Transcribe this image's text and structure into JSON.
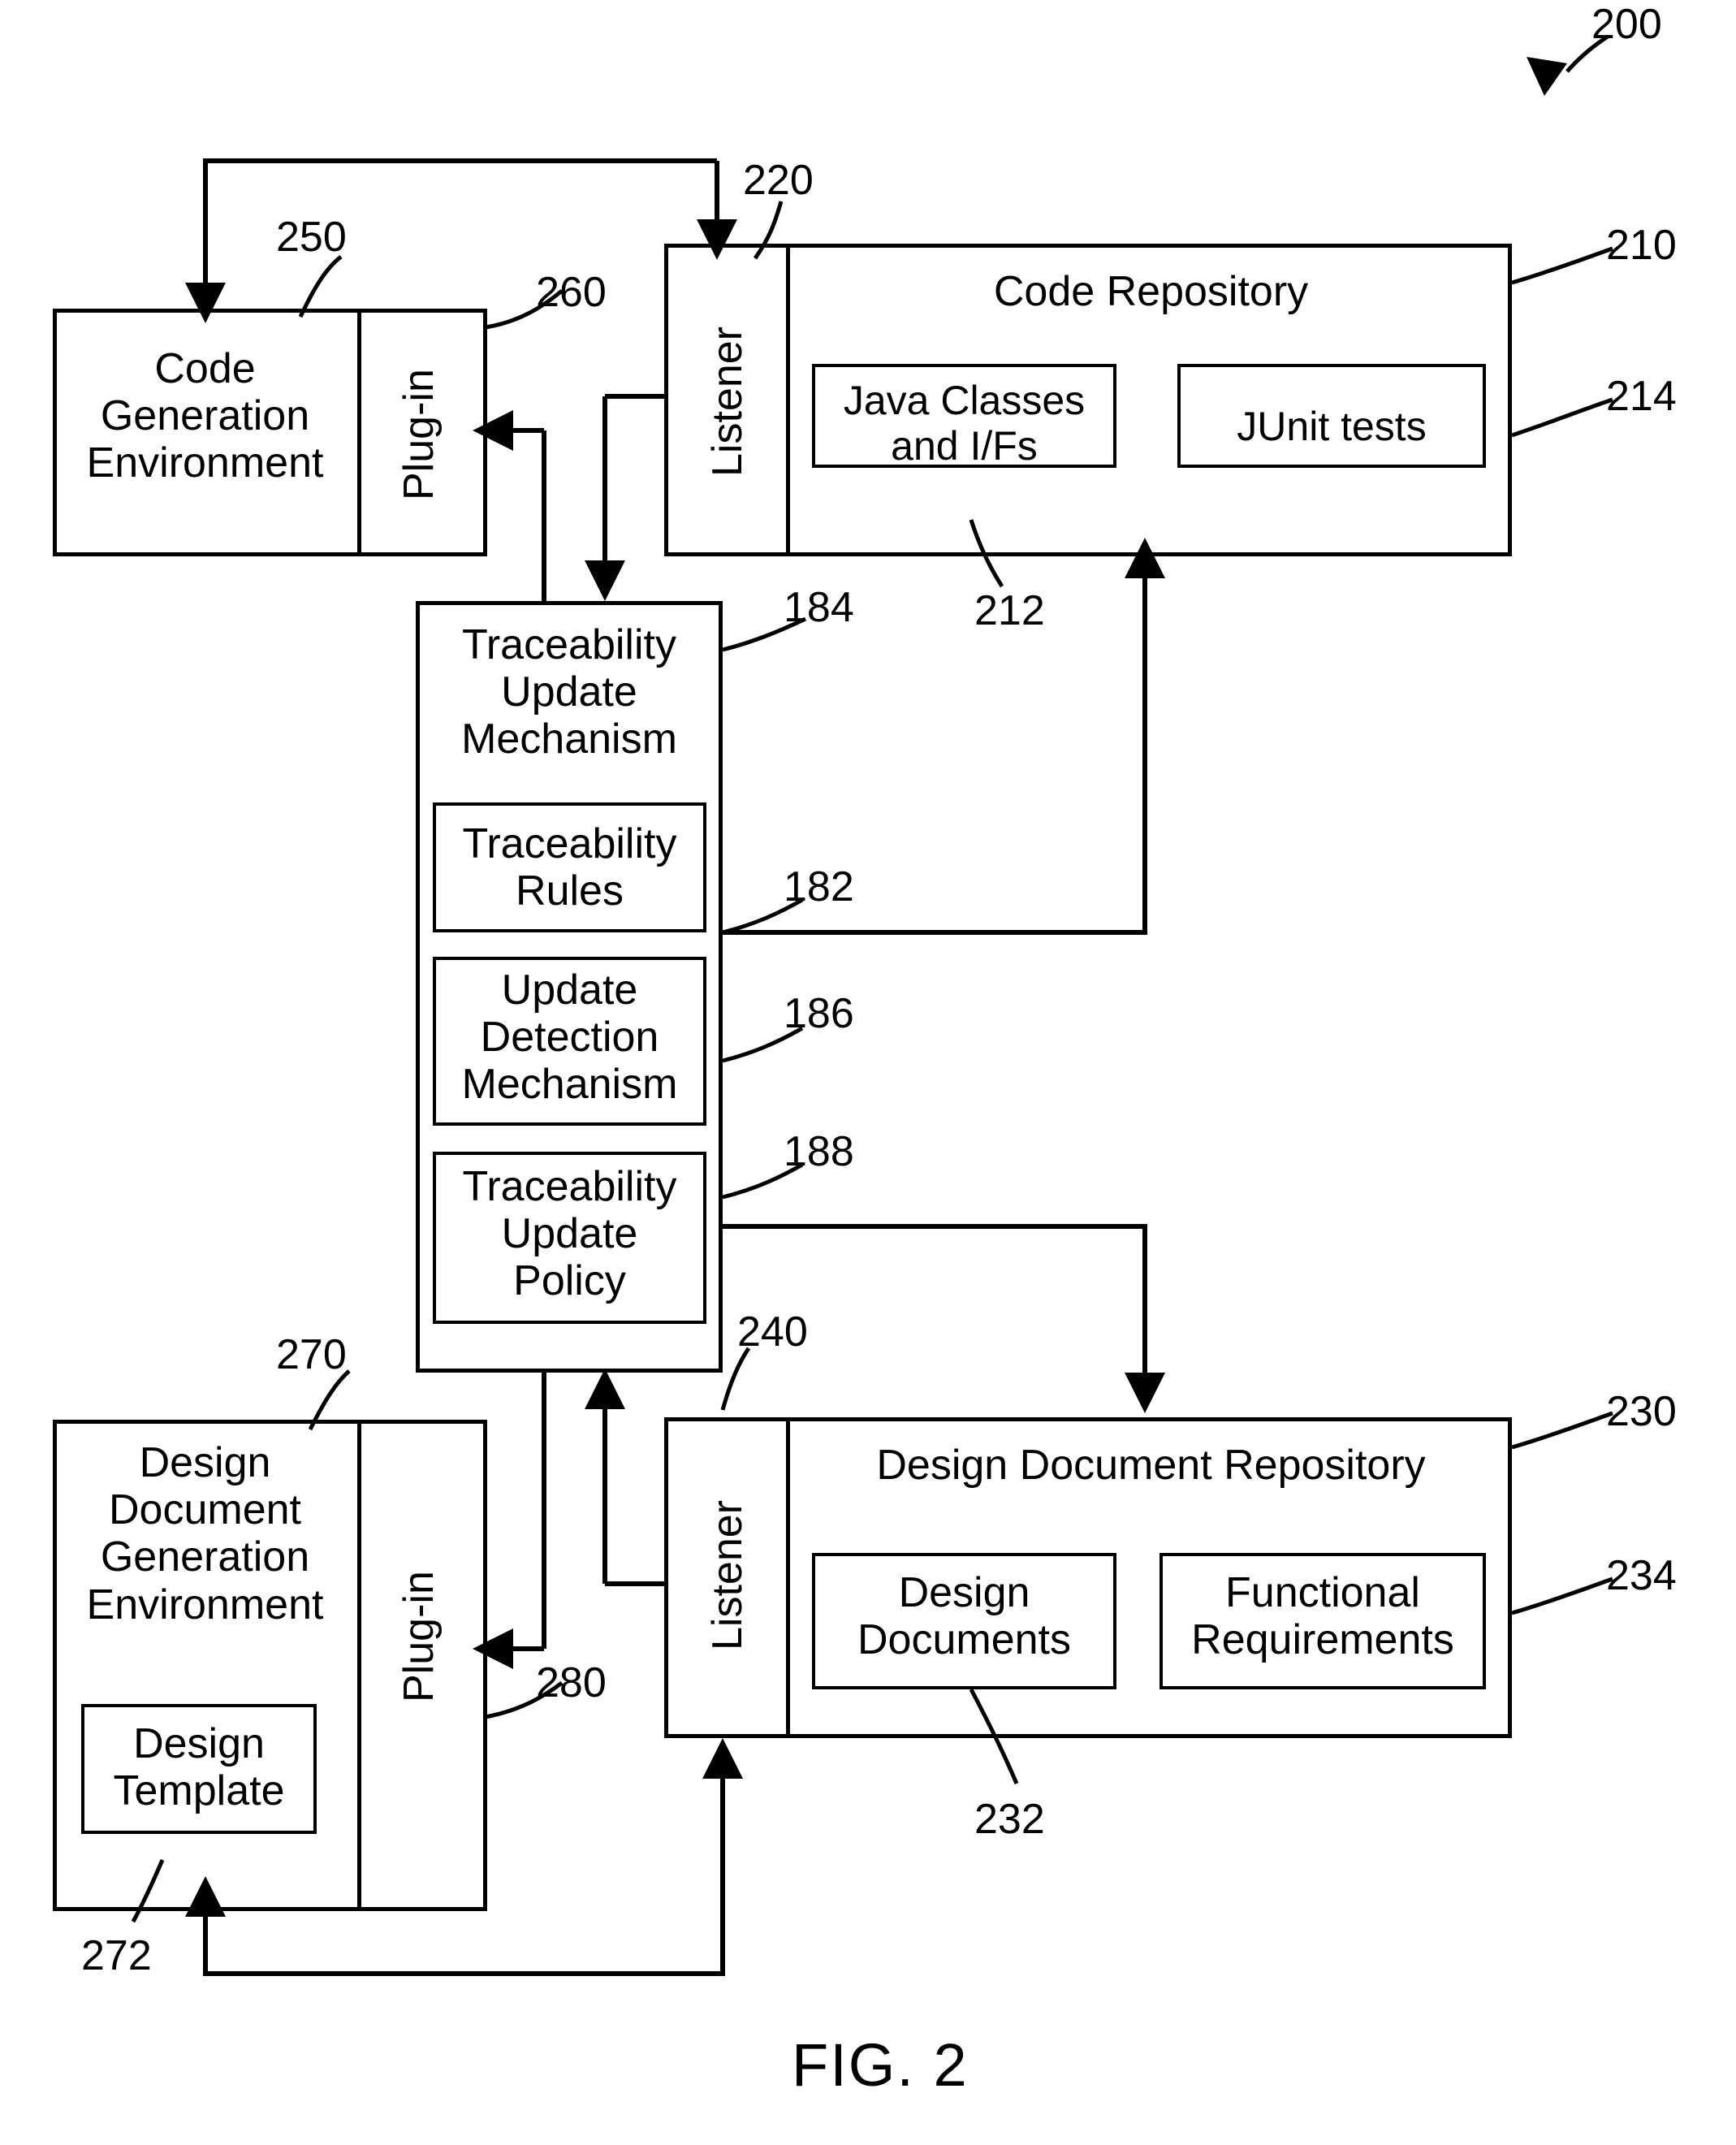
{
  "figure": {
    "caption": "FIG. 2",
    "system_ref": "200"
  },
  "blocks": {
    "code_generation_environment": {
      "label": "Code\nGeneration\nEnvironment",
      "ref": "250"
    },
    "code_gen_plugin": {
      "label": "Plug-in",
      "ref": "260"
    },
    "code_repository": {
      "label": "Code Repository",
      "ref": "210"
    },
    "code_repo_listener": {
      "label": "Listener",
      "ref": "220"
    },
    "java_classes": {
      "label": "Java Classes\nand I/Fs",
      "ref": "212"
    },
    "junit_tests": {
      "label": "JUnit tests",
      "ref": "214"
    },
    "traceability_update_mechanism": {
      "label": "Traceability\nUpdate\nMechanism",
      "ref": "184"
    },
    "traceability_rules": {
      "label": "Traceability\nRules",
      "ref": "182"
    },
    "update_detection_mechanism": {
      "label": "Update\nDetection\nMechanism",
      "ref": "186"
    },
    "traceability_update_policy": {
      "label": "Traceability\nUpdate\nPolicy",
      "ref": "188"
    },
    "design_document_generation_environment": {
      "label": "Design\nDocument\nGeneration\nEnvironment",
      "ref": "270"
    },
    "design_template": {
      "label": "Design\nTemplate",
      "ref": "272"
    },
    "design_doc_plugin": {
      "label": "Plug-in",
      "ref": "280"
    },
    "design_document_repository": {
      "label": "Design Document Repository",
      "ref": "230"
    },
    "design_repo_listener": {
      "label": "Listener",
      "ref": "240"
    },
    "design_documents": {
      "label": "Design\nDocuments",
      "ref": "232"
    },
    "functional_requirements": {
      "label": "Functional\nRequirements",
      "ref": "234"
    }
  },
  "colors": {
    "line": "#000000",
    "background": "#ffffff"
  }
}
